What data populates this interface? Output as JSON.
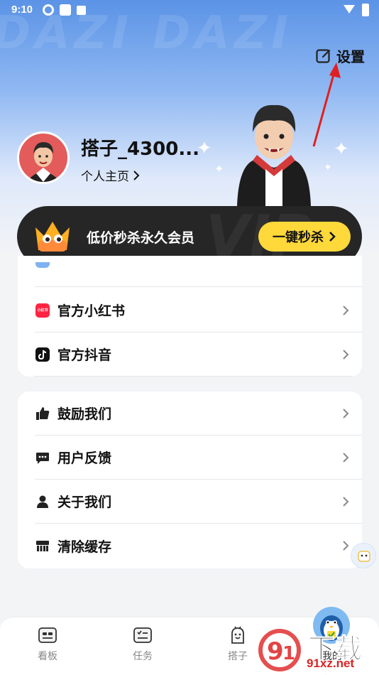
{
  "status_bar": {
    "time": "9:10"
  },
  "header": {
    "settings_label": "设置"
  },
  "profile": {
    "username": "搭子_4300...",
    "homepage_link": "个人主页"
  },
  "vip_banner": {
    "text": "低价秒杀永久会员",
    "button_label": "一键秒杀",
    "bg_text": "VIP"
  },
  "card1": {
    "items": [
      {
        "label": "官方小红书",
        "icon": "xiaohongshu-icon",
        "icon_text": "小红书"
      },
      {
        "label": "官方抖音",
        "icon": "douyin-icon"
      }
    ]
  },
  "card2": {
    "items": [
      {
        "label": "鼓励我们",
        "icon": "thumbs-up-icon"
      },
      {
        "label": "用户反馈",
        "icon": "feedback-icon"
      },
      {
        "label": "关于我们",
        "icon": "person-icon"
      },
      {
        "label": "清除缓存",
        "icon": "clear-cache-icon"
      }
    ]
  },
  "tabbar": {
    "tabs": [
      {
        "label": "看板",
        "icon": "dashboard-icon"
      },
      {
        "label": "任务",
        "icon": "task-icon"
      },
      {
        "label": "搭子",
        "icon": "buddy-icon"
      },
      {
        "label": "我的",
        "icon": "mine-icon"
      }
    ]
  },
  "watermark": {
    "site_name": "下载站",
    "site_url": "91xz.net"
  },
  "colors": {
    "accent_yellow": "#ffd83a",
    "banner_dark": "#262626",
    "hero_blue": "#5b93e6"
  }
}
